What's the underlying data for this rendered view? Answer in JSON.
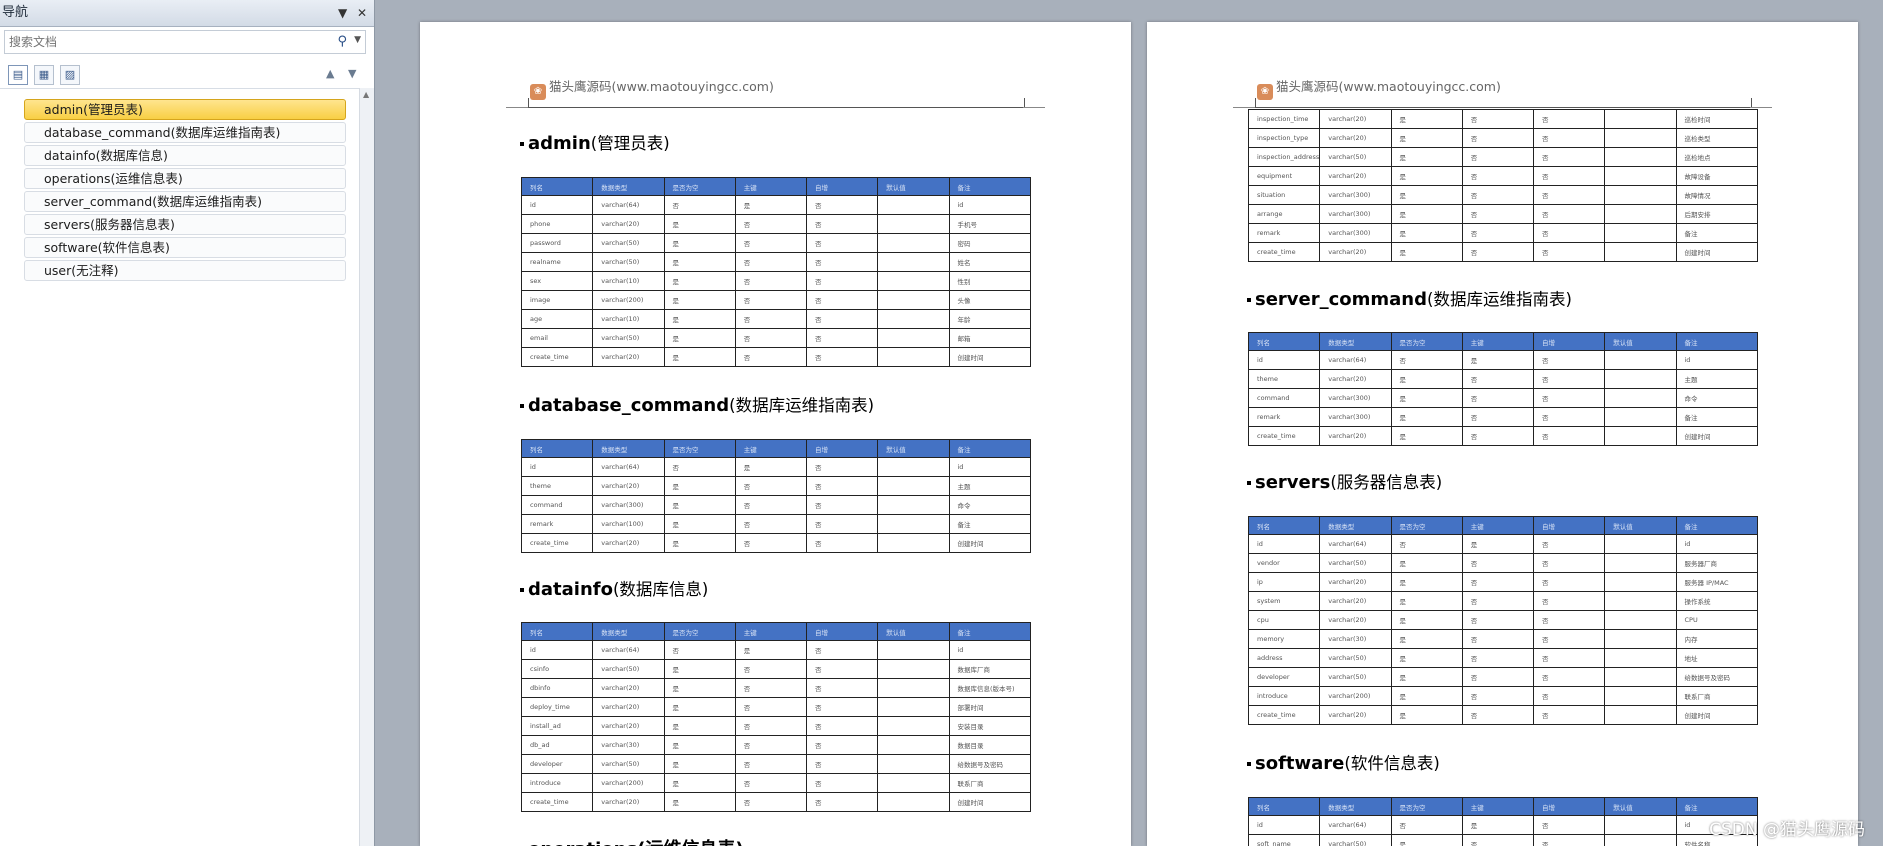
{
  "nav": {
    "title": "导航",
    "dropdown_glyph": "▼",
    "close_glyph": "✕",
    "search_placeholder": "搜索文档",
    "items": [
      "admin(管理员表)",
      "database_command(数据库运维指南表)",
      "datainfo(数据库信息)",
      "operations(运维信息表)",
      "server_command(数据库运维指南表)",
      "servers(服务器信息表)",
      "software(软件信息表)",
      "user(无注释)"
    ],
    "selected_index": 0
  },
  "doc": {
    "header_text": "猫头鹰源码(www.maotouyingcc.com)",
    "columns": [
      "列名",
      "数据类型",
      "是否为空",
      "主键",
      "自增",
      "默认值",
      "备注"
    ],
    "page1": {
      "admin": {
        "name": "admin",
        "cn": "(管理员表)",
        "rows": [
          [
            "id",
            "varchar(64)",
            "否",
            "是",
            "否",
            "",
            "id"
          ],
          [
            "phone",
            "varchar(20)",
            "是",
            "否",
            "否",
            "",
            "手机号"
          ],
          [
            "password",
            "varchar(50)",
            "是",
            "否",
            "否",
            "",
            "密码"
          ],
          [
            "realname",
            "varchar(50)",
            "是",
            "否",
            "否",
            "",
            "姓名"
          ],
          [
            "sex",
            "varchar(10)",
            "是",
            "否",
            "否",
            "",
            "性别"
          ],
          [
            "image",
            "varchar(200)",
            "是",
            "否",
            "否",
            "",
            "头像"
          ],
          [
            "age",
            "varchar(10)",
            "是",
            "否",
            "否",
            "",
            "年龄"
          ],
          [
            "email",
            "varchar(50)",
            "是",
            "否",
            "否",
            "",
            "邮箱"
          ],
          [
            "create_time",
            "varchar(20)",
            "是",
            "否",
            "否",
            "",
            "创建时间"
          ]
        ]
      },
      "database_command": {
        "name": "database_command",
        "cn": "(数据库运维指南表)",
        "rows": [
          [
            "id",
            "varchar(64)",
            "否",
            "是",
            "否",
            "",
            "id"
          ],
          [
            "theme",
            "varchar(20)",
            "是",
            "否",
            "否",
            "",
            "主题"
          ],
          [
            "command",
            "varchar(300)",
            "是",
            "否",
            "否",
            "",
            "命令"
          ],
          [
            "remark",
            "varchar(100)",
            "是",
            "否",
            "否",
            "",
            "备注"
          ],
          [
            "create_time",
            "varchar(20)",
            "是",
            "否",
            "否",
            "",
            "创建时间"
          ]
        ]
      },
      "datainfo": {
        "name": "datainfo",
        "cn": "(数据库信息)",
        "rows": [
          [
            "id",
            "varchar(64)",
            "否",
            "是",
            "否",
            "",
            "id"
          ],
          [
            "csinfo",
            "varchar(50)",
            "是",
            "否",
            "否",
            "",
            "数据库厂商"
          ],
          [
            "dbinfo",
            "varchar(20)",
            "是",
            "否",
            "否",
            "",
            "数据库信息(版本号)"
          ],
          [
            "deploy_time",
            "varchar(20)",
            "是",
            "否",
            "否",
            "",
            "部署时间"
          ],
          [
            "install_ad",
            "varchar(20)",
            "是",
            "否",
            "否",
            "",
            "安装目录"
          ],
          [
            "db_ad",
            "varchar(30)",
            "是",
            "否",
            "否",
            "",
            "数据目录"
          ],
          [
            "developer",
            "varchar(50)",
            "是",
            "否",
            "否",
            "",
            "给数据号及密码"
          ],
          [
            "introduce",
            "varchar(200)",
            "是",
            "否",
            "否",
            "",
            "联系厂商"
          ],
          [
            "create_time",
            "varchar(20)",
            "是",
            "否",
            "否",
            "",
            "创建时间"
          ]
        ]
      },
      "operations_heading": "operations(运维信息表)"
    },
    "page2": {
      "operations_cont": {
        "rows": [
          [
            "inspection_time",
            "varchar(20)",
            "是",
            "否",
            "否",
            "",
            "巡检时间"
          ],
          [
            "inspection_type",
            "varchar(20)",
            "是",
            "否",
            "否",
            "",
            "巡检类型"
          ],
          [
            "inspection_address",
            "varchar(50)",
            "是",
            "否",
            "否",
            "",
            "巡检地点"
          ],
          [
            "equipment",
            "varchar(20)",
            "是",
            "否",
            "否",
            "",
            "故障设备"
          ],
          [
            "situation",
            "varchar(300)",
            "是",
            "否",
            "否",
            "",
            "故障情况"
          ],
          [
            "arrange",
            "varchar(300)",
            "是",
            "否",
            "否",
            "",
            "后期安排"
          ],
          [
            "remark",
            "varchar(300)",
            "是",
            "否",
            "否",
            "",
            "备注"
          ],
          [
            "create_time",
            "varchar(20)",
            "是",
            "否",
            "否",
            "",
            "创建时间"
          ]
        ]
      },
      "server_command": {
        "name": "server_command",
        "cn": "(数据库运维指南表)",
        "rows": [
          [
            "id",
            "varchar(64)",
            "否",
            "是",
            "否",
            "",
            "id"
          ],
          [
            "theme",
            "varchar(20)",
            "是",
            "否",
            "否",
            "",
            "主题"
          ],
          [
            "command",
            "varchar(300)",
            "是",
            "否",
            "否",
            "",
            "命令"
          ],
          [
            "remark",
            "varchar(300)",
            "是",
            "否",
            "否",
            "",
            "备注"
          ],
          [
            "create_time",
            "varchar(20)",
            "是",
            "否",
            "否",
            "",
            "创建时间"
          ]
        ]
      },
      "servers": {
        "name": "servers",
        "cn": "(服务器信息表)",
        "rows": [
          [
            "id",
            "varchar(64)",
            "否",
            "是",
            "否",
            "",
            "id"
          ],
          [
            "vendor",
            "varchar(50)",
            "是",
            "否",
            "否",
            "",
            "服务器厂商"
          ],
          [
            "ip",
            "varchar(20)",
            "是",
            "否",
            "否",
            "",
            "服务器 IP/MAC"
          ],
          [
            "system",
            "varchar(20)",
            "是",
            "否",
            "否",
            "",
            "操作系统"
          ],
          [
            "cpu",
            "varchar(20)",
            "是",
            "否",
            "否",
            "",
            "CPU"
          ],
          [
            "memory",
            "varchar(30)",
            "是",
            "否",
            "否",
            "",
            "内存"
          ],
          [
            "address",
            "varchar(50)",
            "是",
            "否",
            "否",
            "",
            "地址"
          ],
          [
            "developer",
            "varchar(50)",
            "是",
            "否",
            "否",
            "",
            "给数据号及密码"
          ],
          [
            "introduce",
            "varchar(200)",
            "是",
            "否",
            "否",
            "",
            "联系厂商"
          ],
          [
            "create_time",
            "varchar(20)",
            "是",
            "否",
            "否",
            "",
            "创建时间"
          ]
        ]
      },
      "software": {
        "name": "software",
        "cn": "(软件信息表)",
        "rows": [
          [
            "id",
            "varchar(64)",
            "否",
            "是",
            "否",
            "",
            "id"
          ],
          [
            "soft_name",
            "varchar(50)",
            "是",
            "否",
            "否",
            "",
            "软件名称"
          ]
        ]
      }
    }
  },
  "watermark": "CSDN @猫头鹰源码"
}
